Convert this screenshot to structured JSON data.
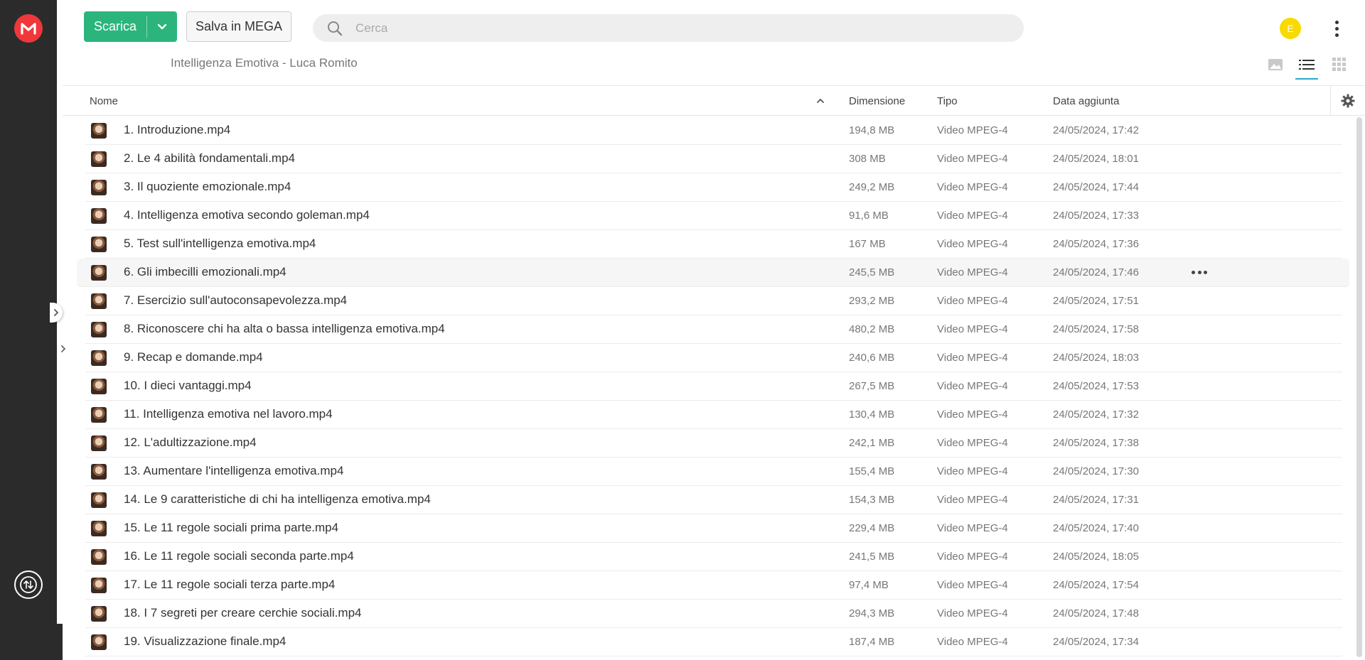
{
  "sidebar": {
    "logo": "mega-logo-icon",
    "sync": "transfers-icon"
  },
  "toolbar": {
    "download_label": "Scarica",
    "save_label": "Salva in MEGA"
  },
  "search": {
    "placeholder": "Cerca"
  },
  "user": {
    "avatar_initial": "E",
    "avatar_color": "#f8d900"
  },
  "breadcrumb": "Intelligenza Emotiva - Luca Romito",
  "accent_color": "#2bb57c",
  "table": {
    "columns": {
      "name": "Nome",
      "size": "Dimensione",
      "type": "Tipo",
      "date": "Data aggiunta"
    },
    "rows": [
      {
        "name": "1. Introduzione.mp4",
        "size": "194,8 MB",
        "type": "Video MPEG-4",
        "date": "24/05/2024, 17:42"
      },
      {
        "name": "2. Le 4 abilità fondamentali.mp4",
        "size": "308 MB",
        "type": "Video MPEG-4",
        "date": "24/05/2024, 18:01"
      },
      {
        "name": "3. Il quoziente emozionale.mp4",
        "size": "249,2 MB",
        "type": "Video MPEG-4",
        "date": "24/05/2024, 17:44"
      },
      {
        "name": "4. Intelligenza emotiva secondo goleman.mp4",
        "size": "91,6 MB",
        "type": "Video MPEG-4",
        "date": "24/05/2024, 17:33"
      },
      {
        "name": "5. Test sull'intelligenza emotiva.mp4",
        "size": "167 MB",
        "type": "Video MPEG-4",
        "date": "24/05/2024, 17:36"
      },
      {
        "name": "6. Gli imbecilli emozionali.mp4",
        "size": "245,5 MB",
        "type": "Video MPEG-4",
        "date": "24/05/2024, 17:46"
      },
      {
        "name": "7. Esercizio sull'autoconsapevolezza.mp4",
        "size": "293,2 MB",
        "type": "Video MPEG-4",
        "date": "24/05/2024, 17:51"
      },
      {
        "name": "8. Riconoscere chi ha alta o bassa intelligenza emotiva.mp4",
        "size": "480,2 MB",
        "type": "Video MPEG-4",
        "date": "24/05/2024, 17:58"
      },
      {
        "name": "9. Recap e domande.mp4",
        "size": "240,6 MB",
        "type": "Video MPEG-4",
        "date": "24/05/2024, 18:03"
      },
      {
        "name": "10. I dieci vantaggi.mp4",
        "size": "267,5 MB",
        "type": "Video MPEG-4",
        "date": "24/05/2024, 17:53"
      },
      {
        "name": "11. Intelligenza emotiva nel lavoro.mp4",
        "size": "130,4 MB",
        "type": "Video MPEG-4",
        "date": "24/05/2024, 17:32"
      },
      {
        "name": "12. L'adultizzazione.mp4",
        "size": "242,1 MB",
        "type": "Video MPEG-4",
        "date": "24/05/2024, 17:38"
      },
      {
        "name": "13. Aumentare l'intelligenza emotiva.mp4",
        "size": "155,4 MB",
        "type": "Video MPEG-4",
        "date": "24/05/2024, 17:30"
      },
      {
        "name": "14. Le 9 caratteristiche di chi ha intelligenza emotiva.mp4",
        "size": "154,3 MB",
        "type": "Video MPEG-4",
        "date": "24/05/2024, 17:31"
      },
      {
        "name": "15. Le 11 regole sociali prima parte.mp4",
        "size": "229,4 MB",
        "type": "Video MPEG-4",
        "date": "24/05/2024, 17:40"
      },
      {
        "name": "16. Le 11 regole sociali seconda parte.mp4",
        "size": "241,5 MB",
        "type": "Video MPEG-4",
        "date": "24/05/2024, 18:05"
      },
      {
        "name": "17. Le 11 regole sociali terza parte.mp4",
        "size": "97,4 MB",
        "type": "Video MPEG-4",
        "date": "24/05/2024, 17:54"
      },
      {
        "name": "18. I 7 segreti per creare cerchie sociali.mp4",
        "size": "294,3 MB",
        "type": "Video MPEG-4",
        "date": "24/05/2024, 17:48"
      },
      {
        "name": "19. Visualizzazione finale.mp4",
        "size": "187,4 MB",
        "type": "Video MPEG-4",
        "date": "24/05/2024, 17:34"
      }
    ]
  }
}
